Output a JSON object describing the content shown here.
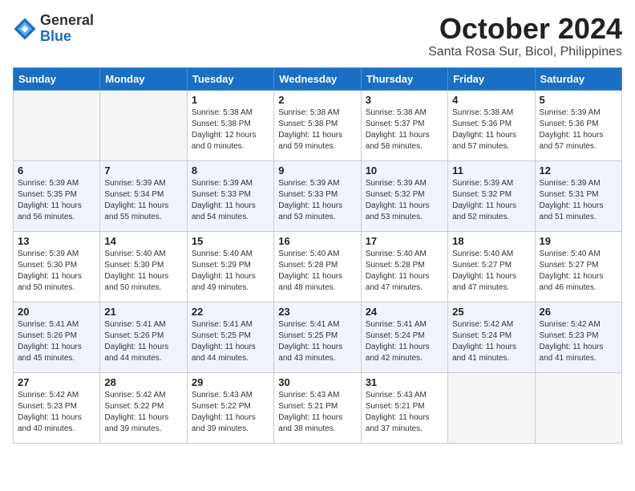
{
  "header": {
    "logo_line1": "General",
    "logo_line2": "Blue",
    "month": "October 2024",
    "location": "Santa Rosa Sur, Bicol, Philippines"
  },
  "weekdays": [
    "Sunday",
    "Monday",
    "Tuesday",
    "Wednesday",
    "Thursday",
    "Friday",
    "Saturday"
  ],
  "weeks": [
    [
      {
        "day": "",
        "text": ""
      },
      {
        "day": "",
        "text": ""
      },
      {
        "day": "1",
        "text": "Sunrise: 5:38 AM\nSunset: 5:38 PM\nDaylight: 12 hours\nand 0 minutes."
      },
      {
        "day": "2",
        "text": "Sunrise: 5:38 AM\nSunset: 5:38 PM\nDaylight: 11 hours\nand 59 minutes."
      },
      {
        "day": "3",
        "text": "Sunrise: 5:38 AM\nSunset: 5:37 PM\nDaylight: 11 hours\nand 58 minutes."
      },
      {
        "day": "4",
        "text": "Sunrise: 5:38 AM\nSunset: 5:36 PM\nDaylight: 11 hours\nand 57 minutes."
      },
      {
        "day": "5",
        "text": "Sunrise: 5:39 AM\nSunset: 5:36 PM\nDaylight: 11 hours\nand 57 minutes."
      }
    ],
    [
      {
        "day": "6",
        "text": "Sunrise: 5:39 AM\nSunset: 5:35 PM\nDaylight: 11 hours\nand 56 minutes."
      },
      {
        "day": "7",
        "text": "Sunrise: 5:39 AM\nSunset: 5:34 PM\nDaylight: 11 hours\nand 55 minutes."
      },
      {
        "day": "8",
        "text": "Sunrise: 5:39 AM\nSunset: 5:33 PM\nDaylight: 11 hours\nand 54 minutes."
      },
      {
        "day": "9",
        "text": "Sunrise: 5:39 AM\nSunset: 5:33 PM\nDaylight: 11 hours\nand 53 minutes."
      },
      {
        "day": "10",
        "text": "Sunrise: 5:39 AM\nSunset: 5:32 PM\nDaylight: 11 hours\nand 53 minutes."
      },
      {
        "day": "11",
        "text": "Sunrise: 5:39 AM\nSunset: 5:32 PM\nDaylight: 11 hours\nand 52 minutes."
      },
      {
        "day": "12",
        "text": "Sunrise: 5:39 AM\nSunset: 5:31 PM\nDaylight: 11 hours\nand 51 minutes."
      }
    ],
    [
      {
        "day": "13",
        "text": "Sunrise: 5:39 AM\nSunset: 5:30 PM\nDaylight: 11 hours\nand 50 minutes."
      },
      {
        "day": "14",
        "text": "Sunrise: 5:40 AM\nSunset: 5:30 PM\nDaylight: 11 hours\nand 50 minutes."
      },
      {
        "day": "15",
        "text": "Sunrise: 5:40 AM\nSunset: 5:29 PM\nDaylight: 11 hours\nand 49 minutes."
      },
      {
        "day": "16",
        "text": "Sunrise: 5:40 AM\nSunset: 5:28 PM\nDaylight: 11 hours\nand 48 minutes."
      },
      {
        "day": "17",
        "text": "Sunrise: 5:40 AM\nSunset: 5:28 PM\nDaylight: 11 hours\nand 47 minutes."
      },
      {
        "day": "18",
        "text": "Sunrise: 5:40 AM\nSunset: 5:27 PM\nDaylight: 11 hours\nand 47 minutes."
      },
      {
        "day": "19",
        "text": "Sunrise: 5:40 AM\nSunset: 5:27 PM\nDaylight: 11 hours\nand 46 minutes."
      }
    ],
    [
      {
        "day": "20",
        "text": "Sunrise: 5:41 AM\nSunset: 5:26 PM\nDaylight: 11 hours\nand 45 minutes."
      },
      {
        "day": "21",
        "text": "Sunrise: 5:41 AM\nSunset: 5:26 PM\nDaylight: 11 hours\nand 44 minutes."
      },
      {
        "day": "22",
        "text": "Sunrise: 5:41 AM\nSunset: 5:25 PM\nDaylight: 11 hours\nand 44 minutes."
      },
      {
        "day": "23",
        "text": "Sunrise: 5:41 AM\nSunset: 5:25 PM\nDaylight: 11 hours\nand 43 minutes."
      },
      {
        "day": "24",
        "text": "Sunrise: 5:41 AM\nSunset: 5:24 PM\nDaylight: 11 hours\nand 42 minutes."
      },
      {
        "day": "25",
        "text": "Sunrise: 5:42 AM\nSunset: 5:24 PM\nDaylight: 11 hours\nand 41 minutes."
      },
      {
        "day": "26",
        "text": "Sunrise: 5:42 AM\nSunset: 5:23 PM\nDaylight: 11 hours\nand 41 minutes."
      }
    ],
    [
      {
        "day": "27",
        "text": "Sunrise: 5:42 AM\nSunset: 5:23 PM\nDaylight: 11 hours\nand 40 minutes."
      },
      {
        "day": "28",
        "text": "Sunrise: 5:42 AM\nSunset: 5:22 PM\nDaylight: 11 hours\nand 39 minutes."
      },
      {
        "day": "29",
        "text": "Sunrise: 5:43 AM\nSunset: 5:22 PM\nDaylight: 11 hours\nand 39 minutes."
      },
      {
        "day": "30",
        "text": "Sunrise: 5:43 AM\nSunset: 5:21 PM\nDaylight: 11 hours\nand 38 minutes."
      },
      {
        "day": "31",
        "text": "Sunrise: 5:43 AM\nSunset: 5:21 PM\nDaylight: 11 hours\nand 37 minutes."
      },
      {
        "day": "",
        "text": ""
      },
      {
        "day": "",
        "text": ""
      }
    ]
  ]
}
